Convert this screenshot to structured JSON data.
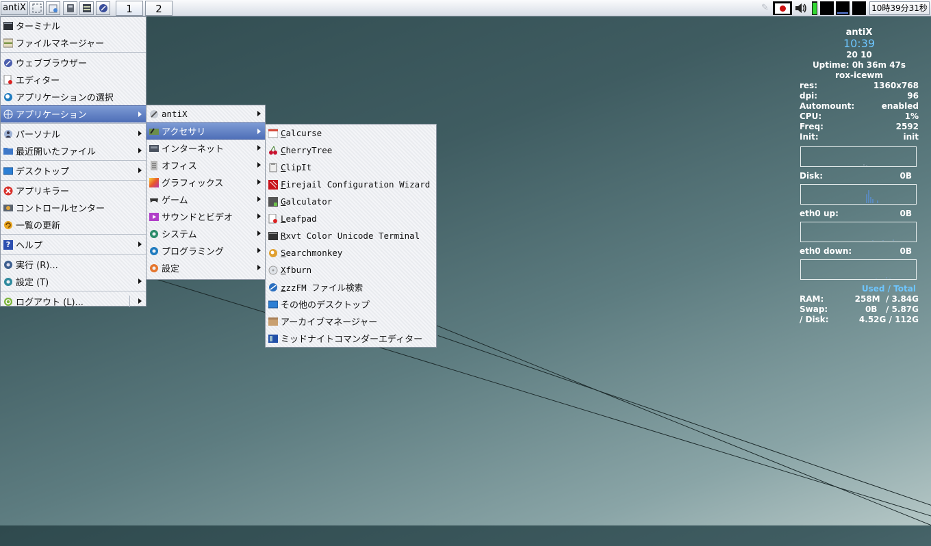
{
  "taskbar": {
    "start_label": "antiX",
    "quick_launch": [
      "fullscreen-icon",
      "file-manager-icon",
      "terminal-icon",
      "editor-icon",
      "browser-icon"
    ],
    "workspaces": [
      "1",
      "2"
    ],
    "tray_flag": "jp-flag-icon",
    "volume": "volume-icon",
    "clock": "10時39分31秒"
  },
  "main_menu": [
    {
      "label": "ターミナル",
      "icon": "terminal-icon"
    },
    {
      "label": "ファイルマネージャー",
      "icon": "file-manager-icon"
    },
    {
      "label": "ウェブブラウザー",
      "icon": "browser-icon"
    },
    {
      "label": "エディター",
      "icon": "editor-icon"
    },
    {
      "label": "アプリケーションの選択",
      "icon": "app-select-icon"
    },
    {
      "label": "アプリケーション",
      "icon": "applications-icon"
    },
    {
      "label": "パーソナル",
      "icon": "personal-icon"
    },
    {
      "label": "最近開いたファイル",
      "icon": "recent-files-icon"
    },
    {
      "label": "デスクトップ",
      "icon": "desktop-icon"
    },
    {
      "label": "アプリキラー",
      "icon": "app-killer-icon"
    },
    {
      "label": "コントロールセンター",
      "icon": "control-center-icon"
    },
    {
      "label": "一覧の更新",
      "icon": "refresh-icon"
    },
    {
      "label": "ヘルプ",
      "icon": "help-icon"
    },
    {
      "label": "実行 (R)...",
      "icon": "run-icon"
    },
    {
      "label": "設定 (T)",
      "icon": "settings-icon"
    },
    {
      "label": "ログアウト (L)...",
      "icon": "logout-icon"
    }
  ],
  "apps_menu": [
    {
      "label": "antiX",
      "icon": "antix-icon"
    },
    {
      "label": "アクセサリ",
      "icon": "accessories-icon"
    },
    {
      "label": "インターネット",
      "icon": "internet-icon"
    },
    {
      "label": "オフィス",
      "icon": "office-icon"
    },
    {
      "label": "グラフィックス",
      "icon": "graphics-icon"
    },
    {
      "label": "ゲーム",
      "icon": "games-icon"
    },
    {
      "label": "サウンドとビデオ",
      "icon": "sound-video-icon"
    },
    {
      "label": "システム",
      "icon": "system-icon"
    },
    {
      "label": "プログラミング",
      "icon": "programming-icon"
    },
    {
      "label": "設定",
      "icon": "settings-icon"
    }
  ],
  "accessories_menu": [
    {
      "first": "C",
      "rest": "alcurse",
      "icon": "calcurse-icon"
    },
    {
      "first": "C",
      "rest": "herryTree",
      "icon": "cherrytree-icon"
    },
    {
      "first": "C",
      "rest": "lipIt",
      "icon": "clipit-icon"
    },
    {
      "first": "F",
      "rest": "irejail Configuration Wizard",
      "icon": "firejail-icon"
    },
    {
      "first": "G",
      "rest": "alculator",
      "icon": "galculator-icon"
    },
    {
      "first": "L",
      "rest": "eafpad",
      "icon": "leafpad-icon"
    },
    {
      "first": "R",
      "rest": "xvt Color Unicode Terminal",
      "icon": "rxvt-icon"
    },
    {
      "first": "S",
      "rest": "earchmonkey",
      "icon": "searchmonkey-icon"
    },
    {
      "first": "X",
      "rest": "fburn",
      "icon": "xfburn-icon"
    },
    {
      "first": "z",
      "rest": "zzFM ファイル検索",
      "icon": "zzzfm-icon"
    },
    {
      "first": "",
      "rest": "その他のデスクトップ",
      "icon": "other-desktop-icon"
    },
    {
      "first": "",
      "rest": "アーカイブマネージャー",
      "icon": "archive-manager-icon"
    },
    {
      "first": "",
      "rest": "ミッドナイトコマンダーエディター",
      "icon": "mc-editor-icon"
    }
  ],
  "conky": {
    "host": "antiX",
    "time": "10:39",
    "date": " 20 10",
    "uptime": "Uptime: 0h 36m 47s",
    "wm": "rox-icewm",
    "stats": [
      {
        "k": "res:",
        "v": "1360x768"
      },
      {
        "k": "dpi:",
        "v": "96"
      },
      {
        "k": "Automount:",
        "v": "enabled"
      },
      {
        "k": "CPU:",
        "v": "1%"
      },
      {
        "k": "Freq:",
        "v": "2592"
      },
      {
        "k": "Init:",
        "v": "init"
      }
    ],
    "disk_label": "Disk:",
    "disk_val": "0B",
    "up_label": "eth0 up:",
    "up_val": "0B",
    "down_label": "eth0 down:",
    "down_val": "0B",
    "used_total": "Used / Total",
    "mem": [
      {
        "k": "RAM:",
        "v": "258M  / 3.84G"
      },
      {
        "k": "Swap:",
        "v": "0B   / 5.87G"
      },
      {
        "k": "/ Disk:",
        "v": "4.52G / 112G"
      }
    ]
  }
}
